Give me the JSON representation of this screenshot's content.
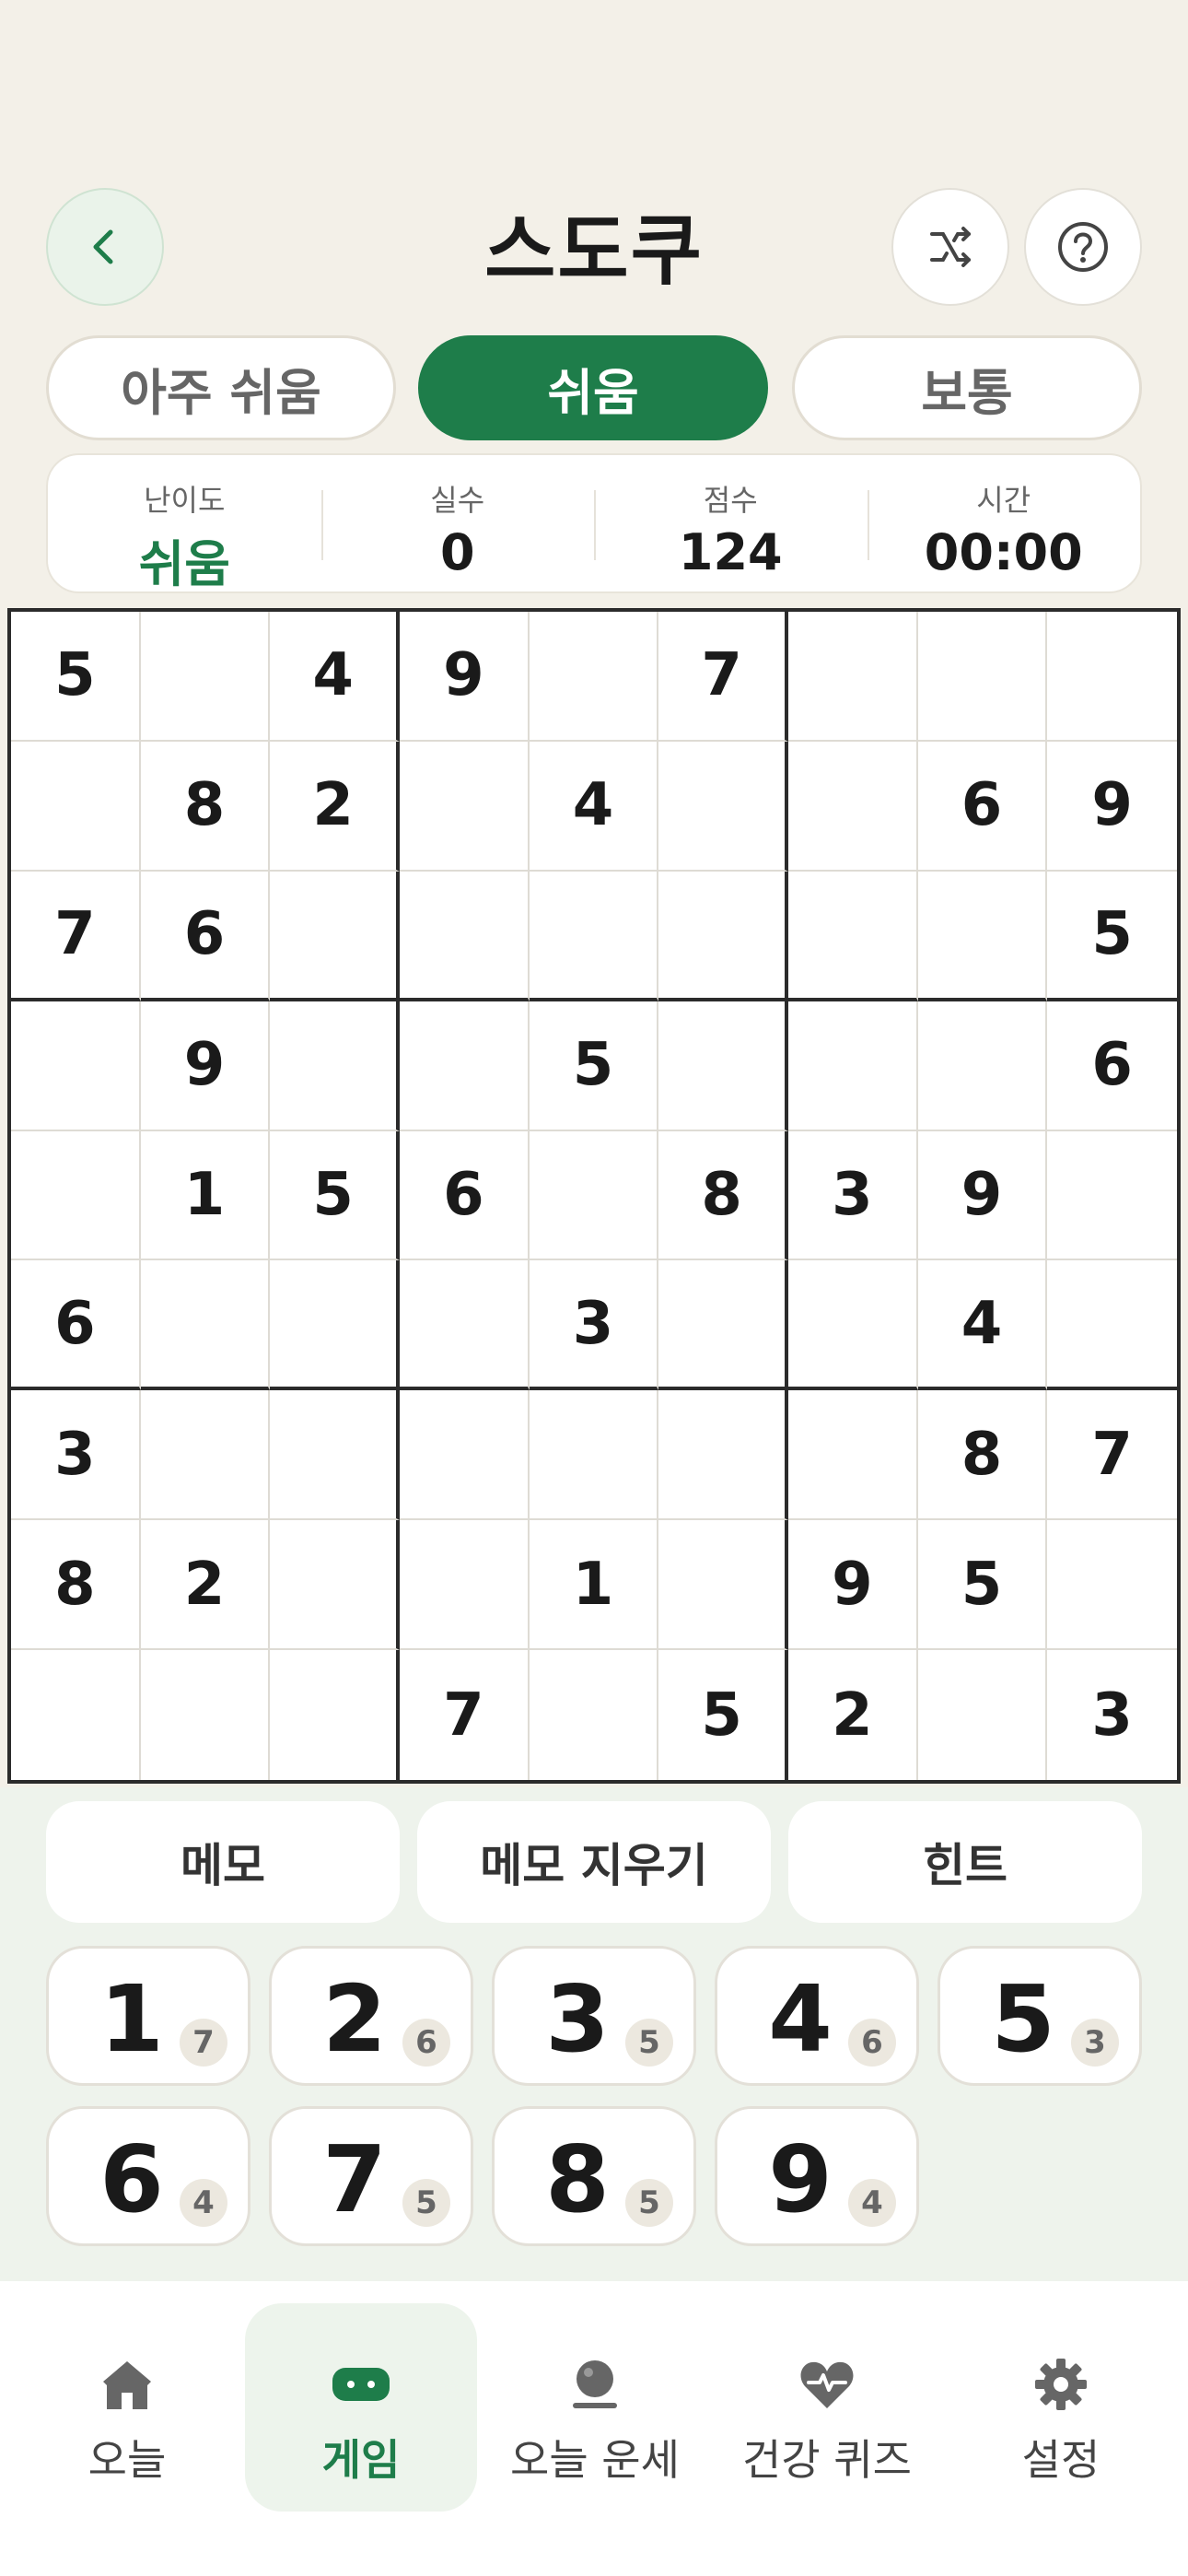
{
  "header": {
    "title": "스도쿠",
    "back_icon": "chevron-left-icon",
    "shuffle_icon": "shuffle-icon",
    "help_icon": "help-circle-icon"
  },
  "difficulty_tabs": [
    {
      "label": "아주 쉬움",
      "active": false
    },
    {
      "label": "쉬움",
      "active": true
    },
    {
      "label": "보통",
      "active": false
    }
  ],
  "stats": {
    "difficulty": {
      "label": "난이도",
      "value": "쉬움"
    },
    "mistakes": {
      "label": "실수",
      "value": "0"
    },
    "score": {
      "label": "점수",
      "value": "124"
    },
    "time": {
      "label": "시간",
      "value": "00:00"
    }
  },
  "board": [
    [
      "5",
      "",
      "4",
      "9",
      "",
      "7",
      "",
      "",
      ""
    ],
    [
      "",
      "8",
      "2",
      "",
      "4",
      "",
      "",
      "6",
      "9"
    ],
    [
      "7",
      "6",
      "",
      "",
      "",
      "",
      "",
      "",
      "5"
    ],
    [
      "",
      "9",
      "",
      "",
      "5",
      "",
      "",
      "",
      "6"
    ],
    [
      "",
      "1",
      "5",
      "6",
      "",
      "8",
      "3",
      "9",
      ""
    ],
    [
      "6",
      "",
      "",
      "",
      "3",
      "",
      "",
      "4",
      ""
    ],
    [
      "3",
      "",
      "",
      "",
      "",
      "",
      "",
      "8",
      "7"
    ],
    [
      "8",
      "2",
      "",
      "",
      "1",
      "",
      "9",
      "5",
      ""
    ],
    [
      "",
      "",
      "",
      "7",
      "",
      "5",
      "2",
      "",
      "3"
    ]
  ],
  "actions": {
    "memo": "메모",
    "clear_memo": "메모 지우기",
    "hint": "힌트"
  },
  "number_pad": [
    {
      "digit": "1",
      "remaining": "7"
    },
    {
      "digit": "2",
      "remaining": "6"
    },
    {
      "digit": "3",
      "remaining": "5"
    },
    {
      "digit": "4",
      "remaining": "6"
    },
    {
      "digit": "5",
      "remaining": "3"
    },
    {
      "digit": "6",
      "remaining": "4"
    },
    {
      "digit": "7",
      "remaining": "5"
    },
    {
      "digit": "8",
      "remaining": "5"
    },
    {
      "digit": "9",
      "remaining": "4"
    }
  ],
  "nav": [
    {
      "label": "오늘",
      "icon": "home-icon",
      "active": false
    },
    {
      "label": "게임",
      "icon": "gamepad-icon",
      "active": true
    },
    {
      "label": "오늘 운세",
      "icon": "crystal-ball-icon",
      "active": false
    },
    {
      "label": "건강 퀴즈",
      "icon": "heart-pulse-icon",
      "active": false
    },
    {
      "label": "설정",
      "icon": "gear-icon",
      "active": false
    }
  ],
  "colors": {
    "accent": "#1e7d4a",
    "background": "#f3f0e8"
  }
}
